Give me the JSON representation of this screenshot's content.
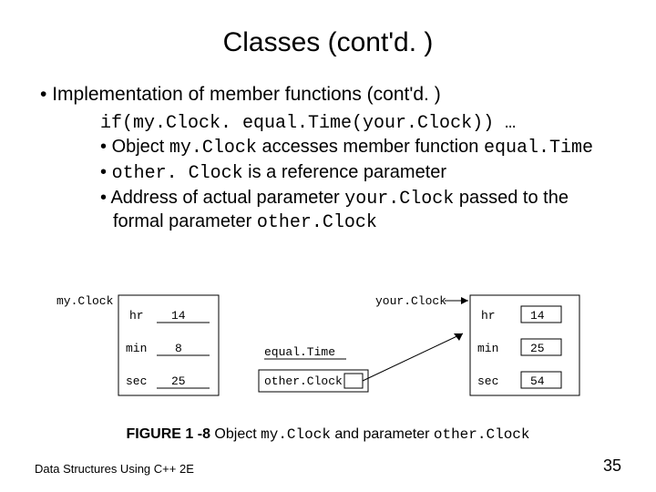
{
  "title": "Classes (cont'd. )",
  "bullets": {
    "l1": "Implementation of member functions (cont'd. )",
    "code": "if(my.Clock. equal.Time(your.Clock)) …",
    "l2a_pre": "Object ",
    "l2a_code1": "my.Clock",
    "l2a_mid": " accesses member function ",
    "l2a_code2": "equal.Time",
    "l2b_code": "other. Clock",
    "l2b_post": " is a reference parameter",
    "l2c_pre": "Address of actual parameter ",
    "l2c_code1": "your.Clock",
    "l2c_mid": " passed to the formal parameter ",
    "l2c_code2": "other.Clock"
  },
  "figure": {
    "myClockLabel": "my.Clock",
    "yourClockLabel": "your.Clock",
    "fields": {
      "hr": "hr",
      "min": "min",
      "sec": "sec"
    },
    "myVals": {
      "hr": "14",
      "min": "8",
      "sec": "25"
    },
    "yourVals": {
      "hr": "14",
      "min": "25",
      "sec": "54"
    },
    "equalTime": "equal.Time",
    "otherClock": "other.Clock"
  },
  "caption": {
    "bold": "FIGURE 1 -8",
    "pre": " Object ",
    "code1": "my.Clock",
    "mid": " and parameter ",
    "code2": "other.Clock"
  },
  "footer": {
    "left": "Data Structures Using C++ 2E",
    "right": "35"
  }
}
